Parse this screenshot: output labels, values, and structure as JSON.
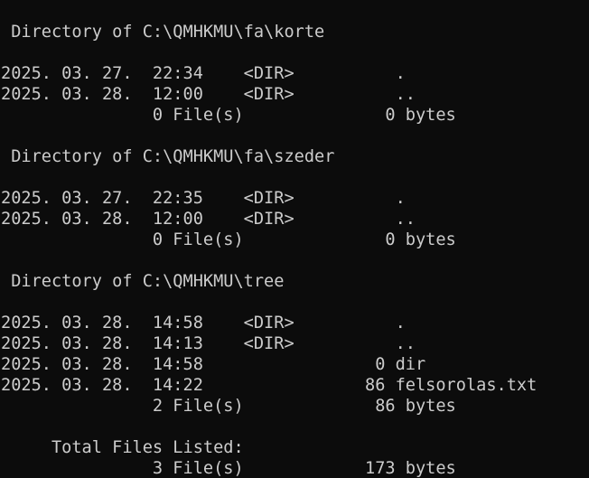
{
  "terminal": {
    "colors": {
      "background": "#0c0c0c",
      "foreground": "#cccccc"
    },
    "lines": [
      " Directory of C:\\QMHKMU\\fa\\korte",
      "2025. 03. 27.  22:34    <DIR>          .",
      "2025. 03. 28.  12:00    <DIR>          ..",
      "               0 File(s)              0 bytes",
      " Directory of C:\\QMHKMU\\fa\\szeder",
      "2025. 03. 27.  22:35    <DIR>          .",
      "2025. 03. 28.  12:00    <DIR>          ..",
      "               0 File(s)              0 bytes",
      " Directory of C:\\QMHKMU\\tree",
      "2025. 03. 28.  14:58    <DIR>          .",
      "2025. 03. 28.  14:13    <DIR>          ..",
      "2025. 03. 28.  14:58                 0 dir",
      "2025. 03. 28.  14:22                86 felsorolas.txt",
      "               2 File(s)             86 bytes",
      "     Total Files Listed:",
      "               3 File(s)            173 bytes"
    ]
  }
}
